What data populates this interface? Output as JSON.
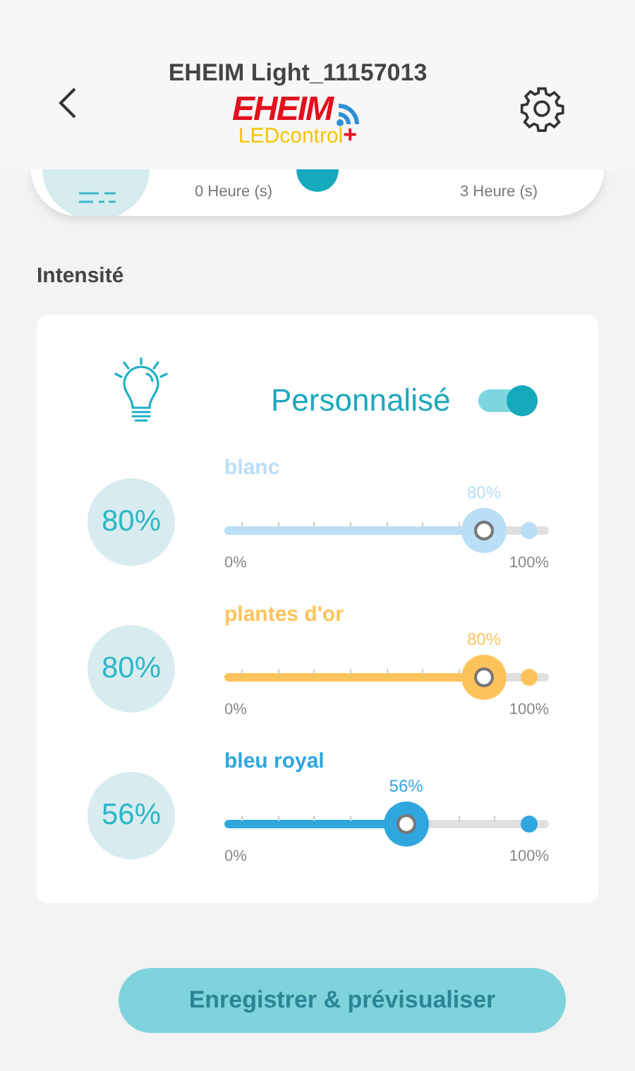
{
  "header": {
    "title": "EHEIM Light_11157013",
    "logo": {
      "brand": "EHEIM",
      "product": "LEDcontrol",
      "plus": "+"
    }
  },
  "schedule_card": {
    "start_label": "0 Heure (s)",
    "end_label": "3 Heure (s)"
  },
  "section_title": "Intensité",
  "mode": {
    "label": "Personnalisé",
    "on": true
  },
  "channels": [
    {
      "name": "blanc",
      "value": "80%",
      "reading": "80%",
      "level": 0.8,
      "color": "#b9def6",
      "min_label": "0%",
      "max_label": "100%"
    },
    {
      "name": "plantes d'or",
      "value": "80%",
      "reading": "80%",
      "level": 0.8,
      "color": "#fdc35b",
      "min_label": "0%",
      "max_label": "100%"
    },
    {
      "name": "bleu royal",
      "value": "56%",
      "reading": "56%",
      "level": 0.56,
      "color": "#2fa6de",
      "min_label": "0%",
      "max_label": "100%"
    }
  ],
  "save_button": "Enregistrer & prévisualiser"
}
